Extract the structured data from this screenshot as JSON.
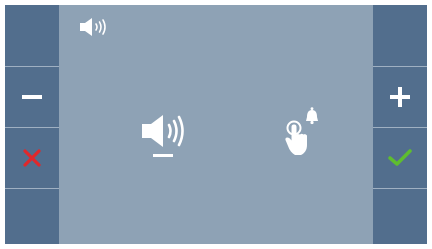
{
  "screen": {
    "status": {
      "icon": "speaker-volume-icon"
    },
    "volume": {
      "icon": "speaker-volume-icon",
      "level_indicator": "–"
    },
    "touch": {
      "icon": "touch-bell-icon"
    }
  },
  "left_panel": {
    "buttons": [
      {
        "icon": "empty"
      },
      {
        "icon": "minus-icon"
      },
      {
        "icon": "cancel-icon",
        "color": "#e0282b"
      },
      {
        "icon": "empty"
      }
    ]
  },
  "right_panel": {
    "buttons": [
      {
        "icon": "empty"
      },
      {
        "icon": "plus-icon"
      },
      {
        "icon": "confirm-icon",
        "color": "#5ebd2f"
      },
      {
        "icon": "empty"
      }
    ]
  },
  "colors": {
    "background": "#8ea2b5",
    "panel": "#526e8d",
    "separator": "#9fb0c2",
    "cancel": "#e0282b",
    "confirm": "#5ebd2f",
    "icon": "#ffffff"
  }
}
